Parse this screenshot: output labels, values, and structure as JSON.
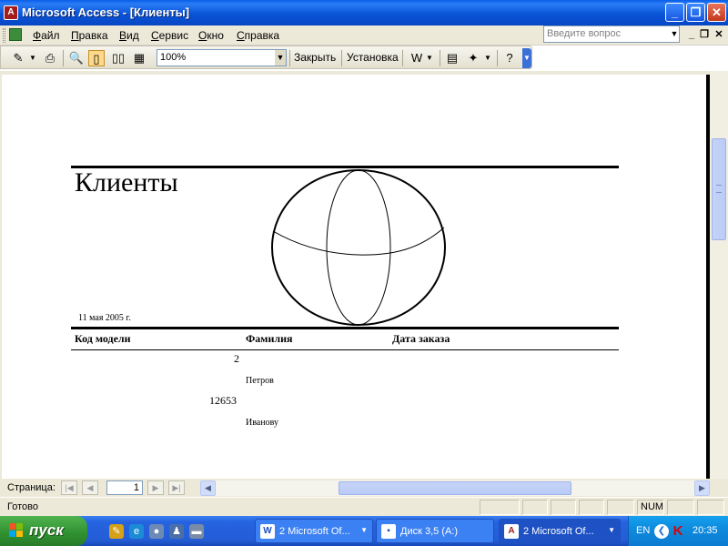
{
  "window": {
    "title": "Microsoft Access - [Клиенты]",
    "app_icon": "access-icon"
  },
  "menu": {
    "items": [
      "Файл",
      "Правка",
      "Вид",
      "Сервис",
      "Окно",
      "Справка"
    ],
    "ask_placeholder": "Введите вопрос"
  },
  "toolbar": {
    "zoom": "100%",
    "close_label": "Закрыть",
    "setup_label": "Установка"
  },
  "report": {
    "title": "Клиенты",
    "date": "11 мая 2005 г.",
    "columns": [
      "Код модели",
      "Фамилия",
      "Дата заказа"
    ],
    "rows": [
      {
        "code": "2",
        "surname": "Петров"
      },
      {
        "code": "12653",
        "surname": "Иванову"
      }
    ]
  },
  "navigation": {
    "page_label": "Страница:",
    "page_number": "1"
  },
  "status": {
    "text": "Готово",
    "num": "NUM"
  },
  "taskbar": {
    "start_label": "пуск",
    "tasks": [
      {
        "label": "2 Microsoft Of...",
        "active": false
      },
      {
        "label": "Диск 3,5 (A:)",
        "active": false
      },
      {
        "label": "2 Microsoft Of...",
        "active": true
      }
    ],
    "language": "EN",
    "clock": "20:35"
  },
  "colors": {
    "title_bar": "#0a55d8",
    "taskbar": "#245dd6",
    "start_button": "#2f8f2f"
  }
}
